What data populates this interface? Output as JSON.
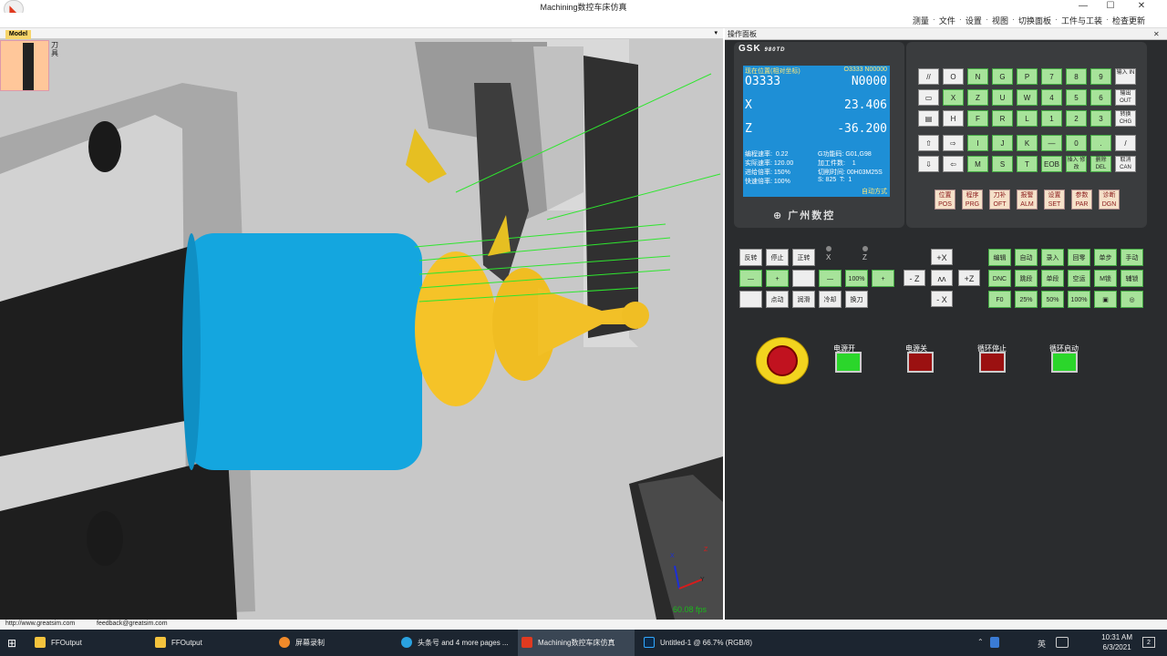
{
  "window": {
    "title": "Machining数控车床仿真",
    "minimize": "—",
    "maximize": "☐",
    "close": "✕"
  },
  "menu": [
    "测量",
    "文件",
    "设置",
    "视图",
    "切换面板",
    "工件与工装",
    "检查更新"
  ],
  "viewport": {
    "model_tab": "Model",
    "tool_tab": "刀具",
    "fps": "60.08 fps",
    "axis_labels": [
      "X",
      "Y",
      "Z"
    ]
  },
  "panel": {
    "header": "操作面板",
    "cnc_brand": "GSK",
    "cnc_model": "980TD",
    "maker": "广州数控",
    "screen": {
      "heading": "现在位置(相对坐标)",
      "prog_header": "O3333  N00000",
      "program": "O3333",
      "block": "N0000",
      "x_label": "X",
      "x_value": "23.406",
      "z_label": "Z",
      "z_value": "-36.200",
      "left_lines": [
        "编程速率:  0.22",
        "实际速率: 120.00",
        "进给倍率: 150%",
        "快速倍率: 100%"
      ],
      "right_lines": [
        "G功能码: G01,G98",
        "加工件数:    1",
        "切削时间: 00H03M25S",
        "S: 825  T:  1"
      ],
      "mode": "自动方式"
    },
    "keys": [
      [
        "//",
        "O",
        "N",
        "G",
        "P",
        "7",
        "8",
        "9",
        "输入 IN"
      ],
      [
        "▭",
        "X",
        "Z",
        "U",
        "W",
        "4",
        "5",
        "6",
        "输出 OUT"
      ],
      [
        "▤",
        "H",
        "F",
        "R",
        "L",
        "1",
        "2",
        "3",
        "转换 CHG"
      ],
      [
        "⇧",
        "⇨",
        "I",
        "J",
        "K",
        "—",
        "0",
        ".",
        "/"
      ],
      [
        "⇩",
        "⇦",
        "M",
        "S",
        "T",
        "EOB",
        "插入 修改",
        "删除 DEL",
        "取消 CAN"
      ]
    ],
    "func_keys": [
      "位置 POS",
      "程序 PRG",
      "刀补 OFT",
      "报警 ALM",
      "设置 SET",
      "参数 PAR",
      "诊断 DGN"
    ],
    "spindle_ctrl": [
      "反转",
      "停止",
      "正转",
      "—",
      "+",
      "",
      "",
      "点动",
      "润滑",
      "冷却",
      "换刀"
    ],
    "feed_ctrl": [
      "—",
      "100%",
      "+"
    ],
    "axis_buttons": {
      "px": "+X",
      "nx": "- X",
      "pz": "+Z",
      "nz": "- Z",
      "center": "ʌʌ",
      "x_lbl": "X",
      "z_lbl": "Z"
    },
    "mode_ctrl": [
      "编辑",
      "自动",
      "录入",
      "回零",
      "单步",
      "手动",
      "DNC",
      "跳段",
      "单段",
      "空运",
      "M锁",
      "辅锁",
      "F0",
      "25%",
      "50%",
      "100%",
      "▣",
      "◎"
    ],
    "lamps": [
      {
        "label": "电源开",
        "color": "#2bd62b"
      },
      {
        "label": "电源关",
        "color": "#9b1111"
      },
      {
        "label": "循环停止",
        "color": "#9b1111"
      },
      {
        "label": "循环启动",
        "color": "#2bd62b"
      }
    ]
  },
  "status": {
    "site": "http://www.greatsim.com",
    "feedback": "feedback@greatsim.com"
  },
  "taskbar": {
    "items": [
      "FFOutput",
      "FFOutput",
      "屏幕录制",
      "头条号 and 4 more pages ...",
      "Machining数控车床仿真",
      "Untitled-1 @ 66.7% (RGB/8)"
    ],
    "lang": "英",
    "time": "10:31 AM",
    "date": "6/3/2021",
    "notif": "2"
  }
}
